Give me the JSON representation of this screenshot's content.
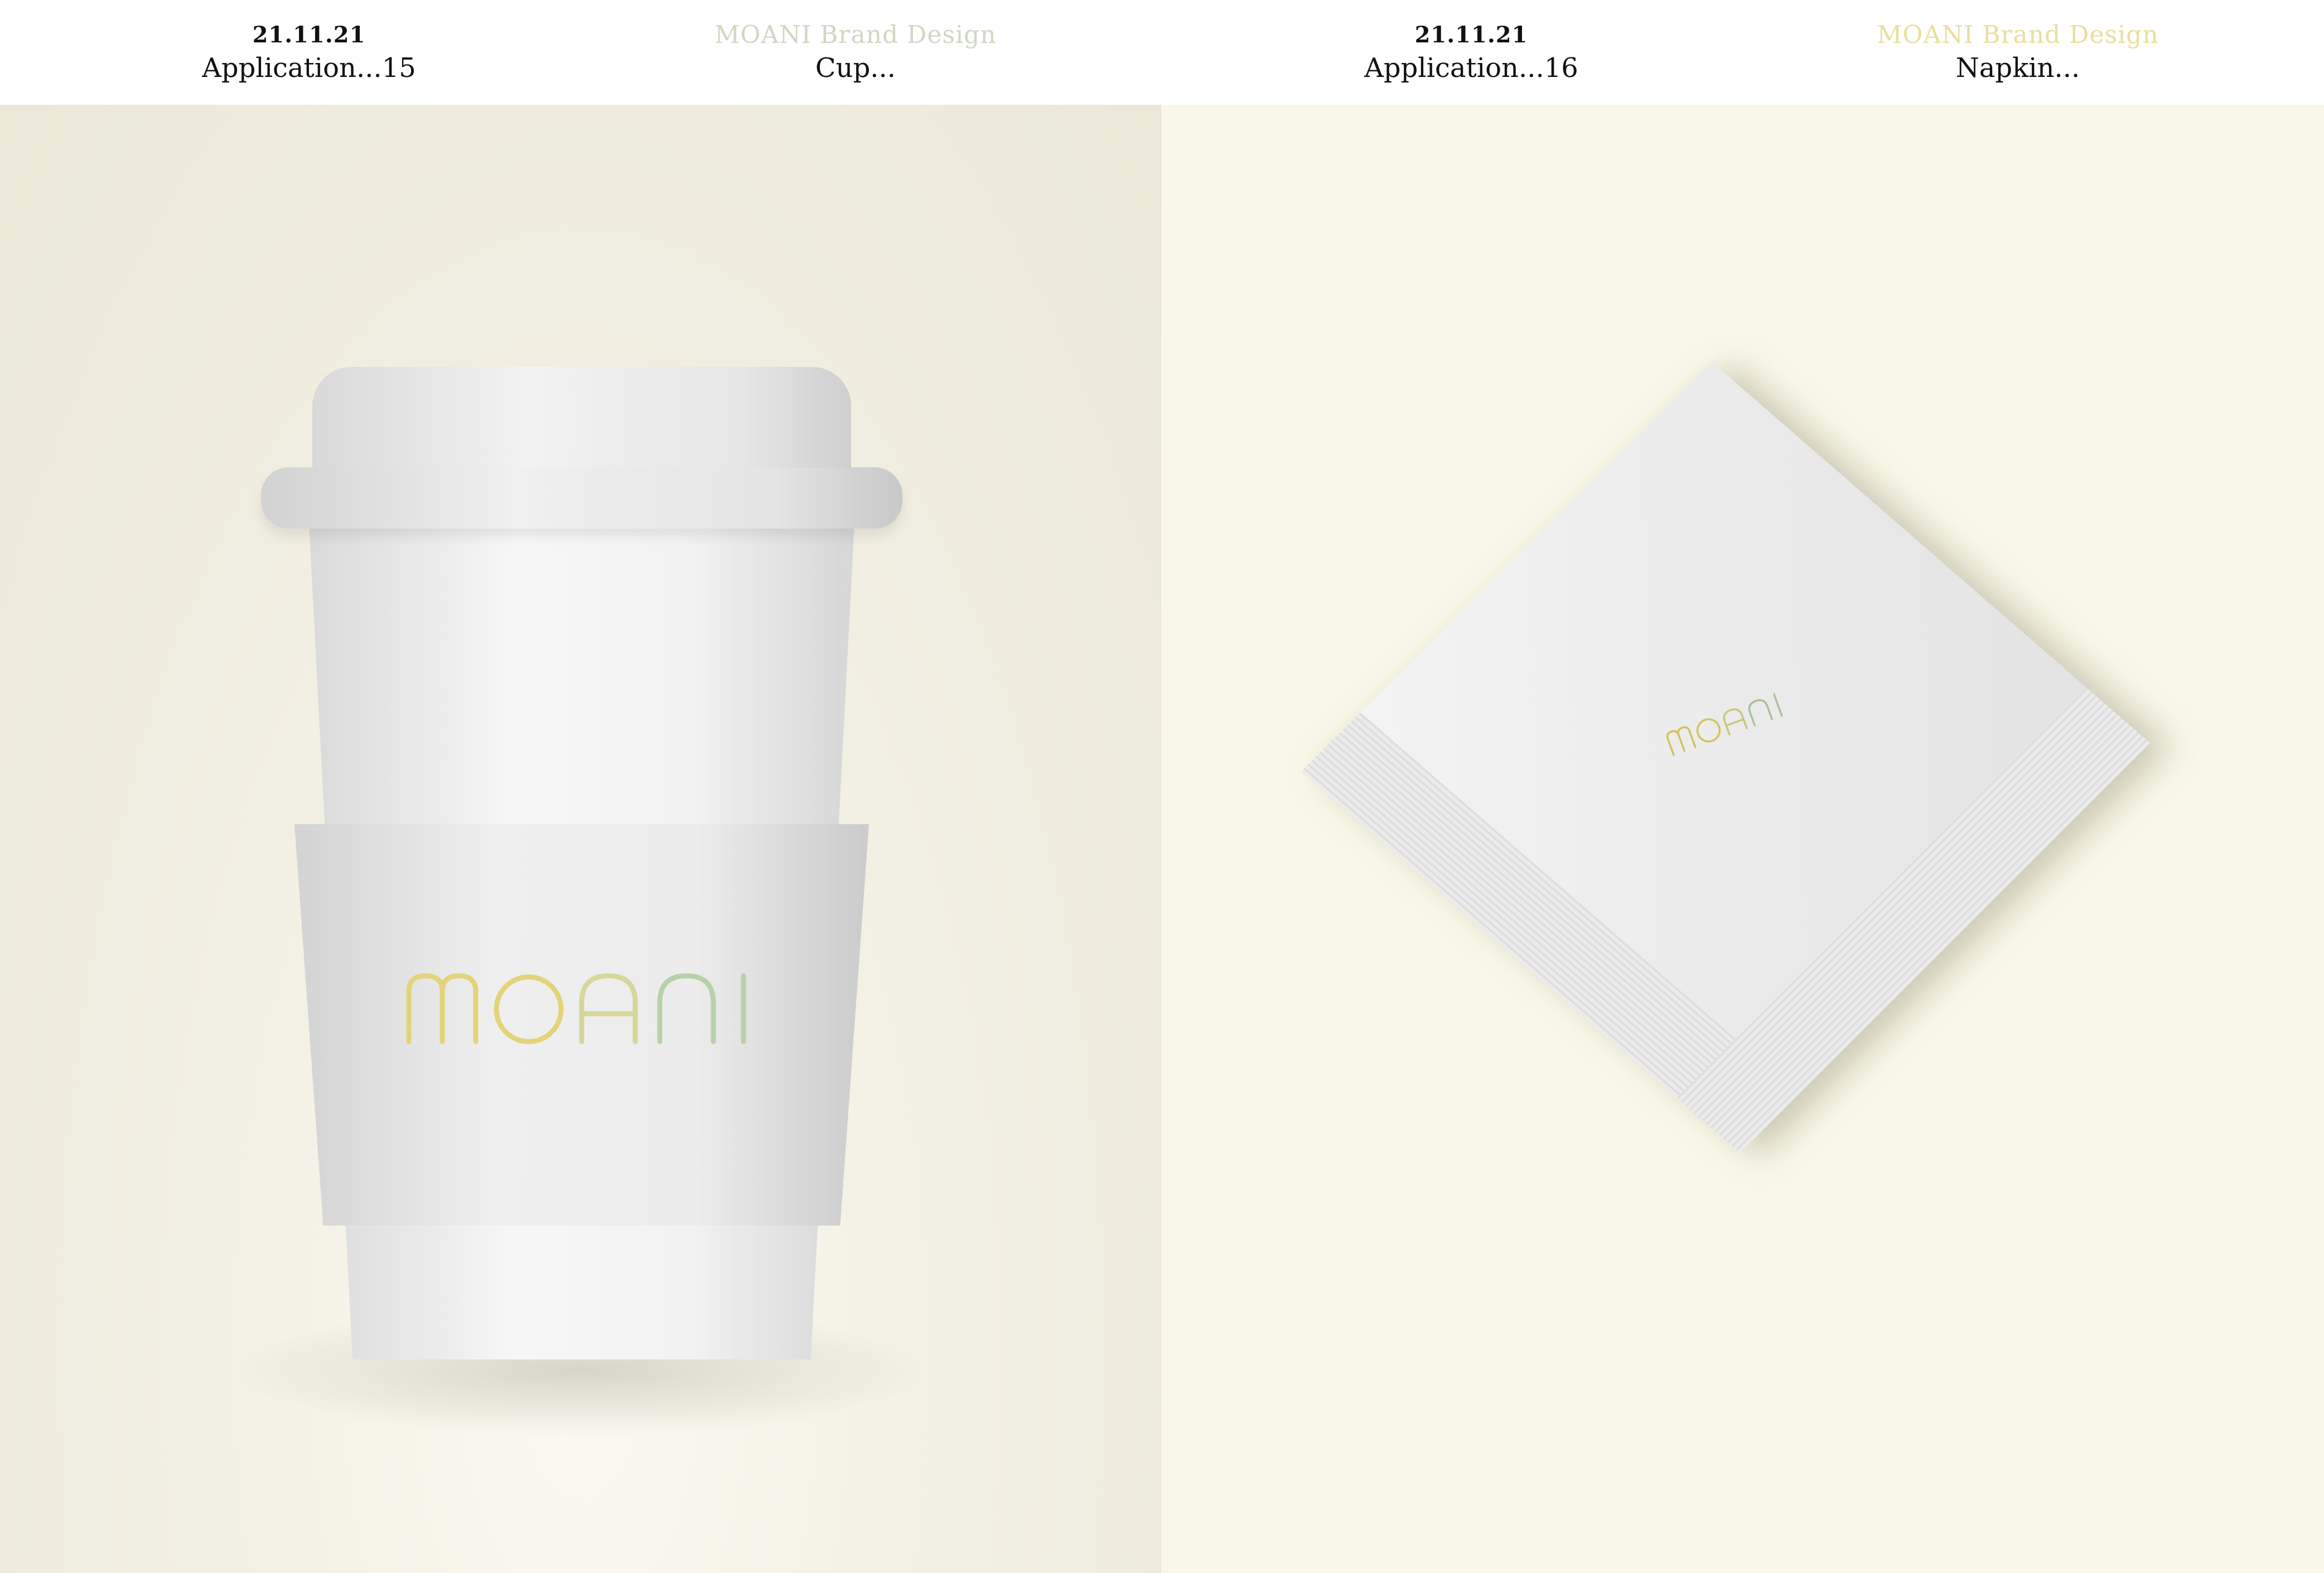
{
  "colors": {
    "green_title": "#cfd8c2",
    "yellow_title": "#e9df9c",
    "logo_yellow": "#e5d37a",
    "logo_green": "#b9d1a9",
    "logo_mid": "#d7d79a"
  },
  "left_page": {
    "date": "21.11.21",
    "application": "Application...15",
    "brand": "MOANI Brand Design",
    "item": "Cup..."
  },
  "right_page": {
    "date": "21.11.21",
    "application": "Application...16",
    "brand": "MOANI Brand Design",
    "item": "Napkin..."
  },
  "logo": {
    "letters": [
      "M",
      "O",
      "A",
      "N",
      "I"
    ]
  }
}
